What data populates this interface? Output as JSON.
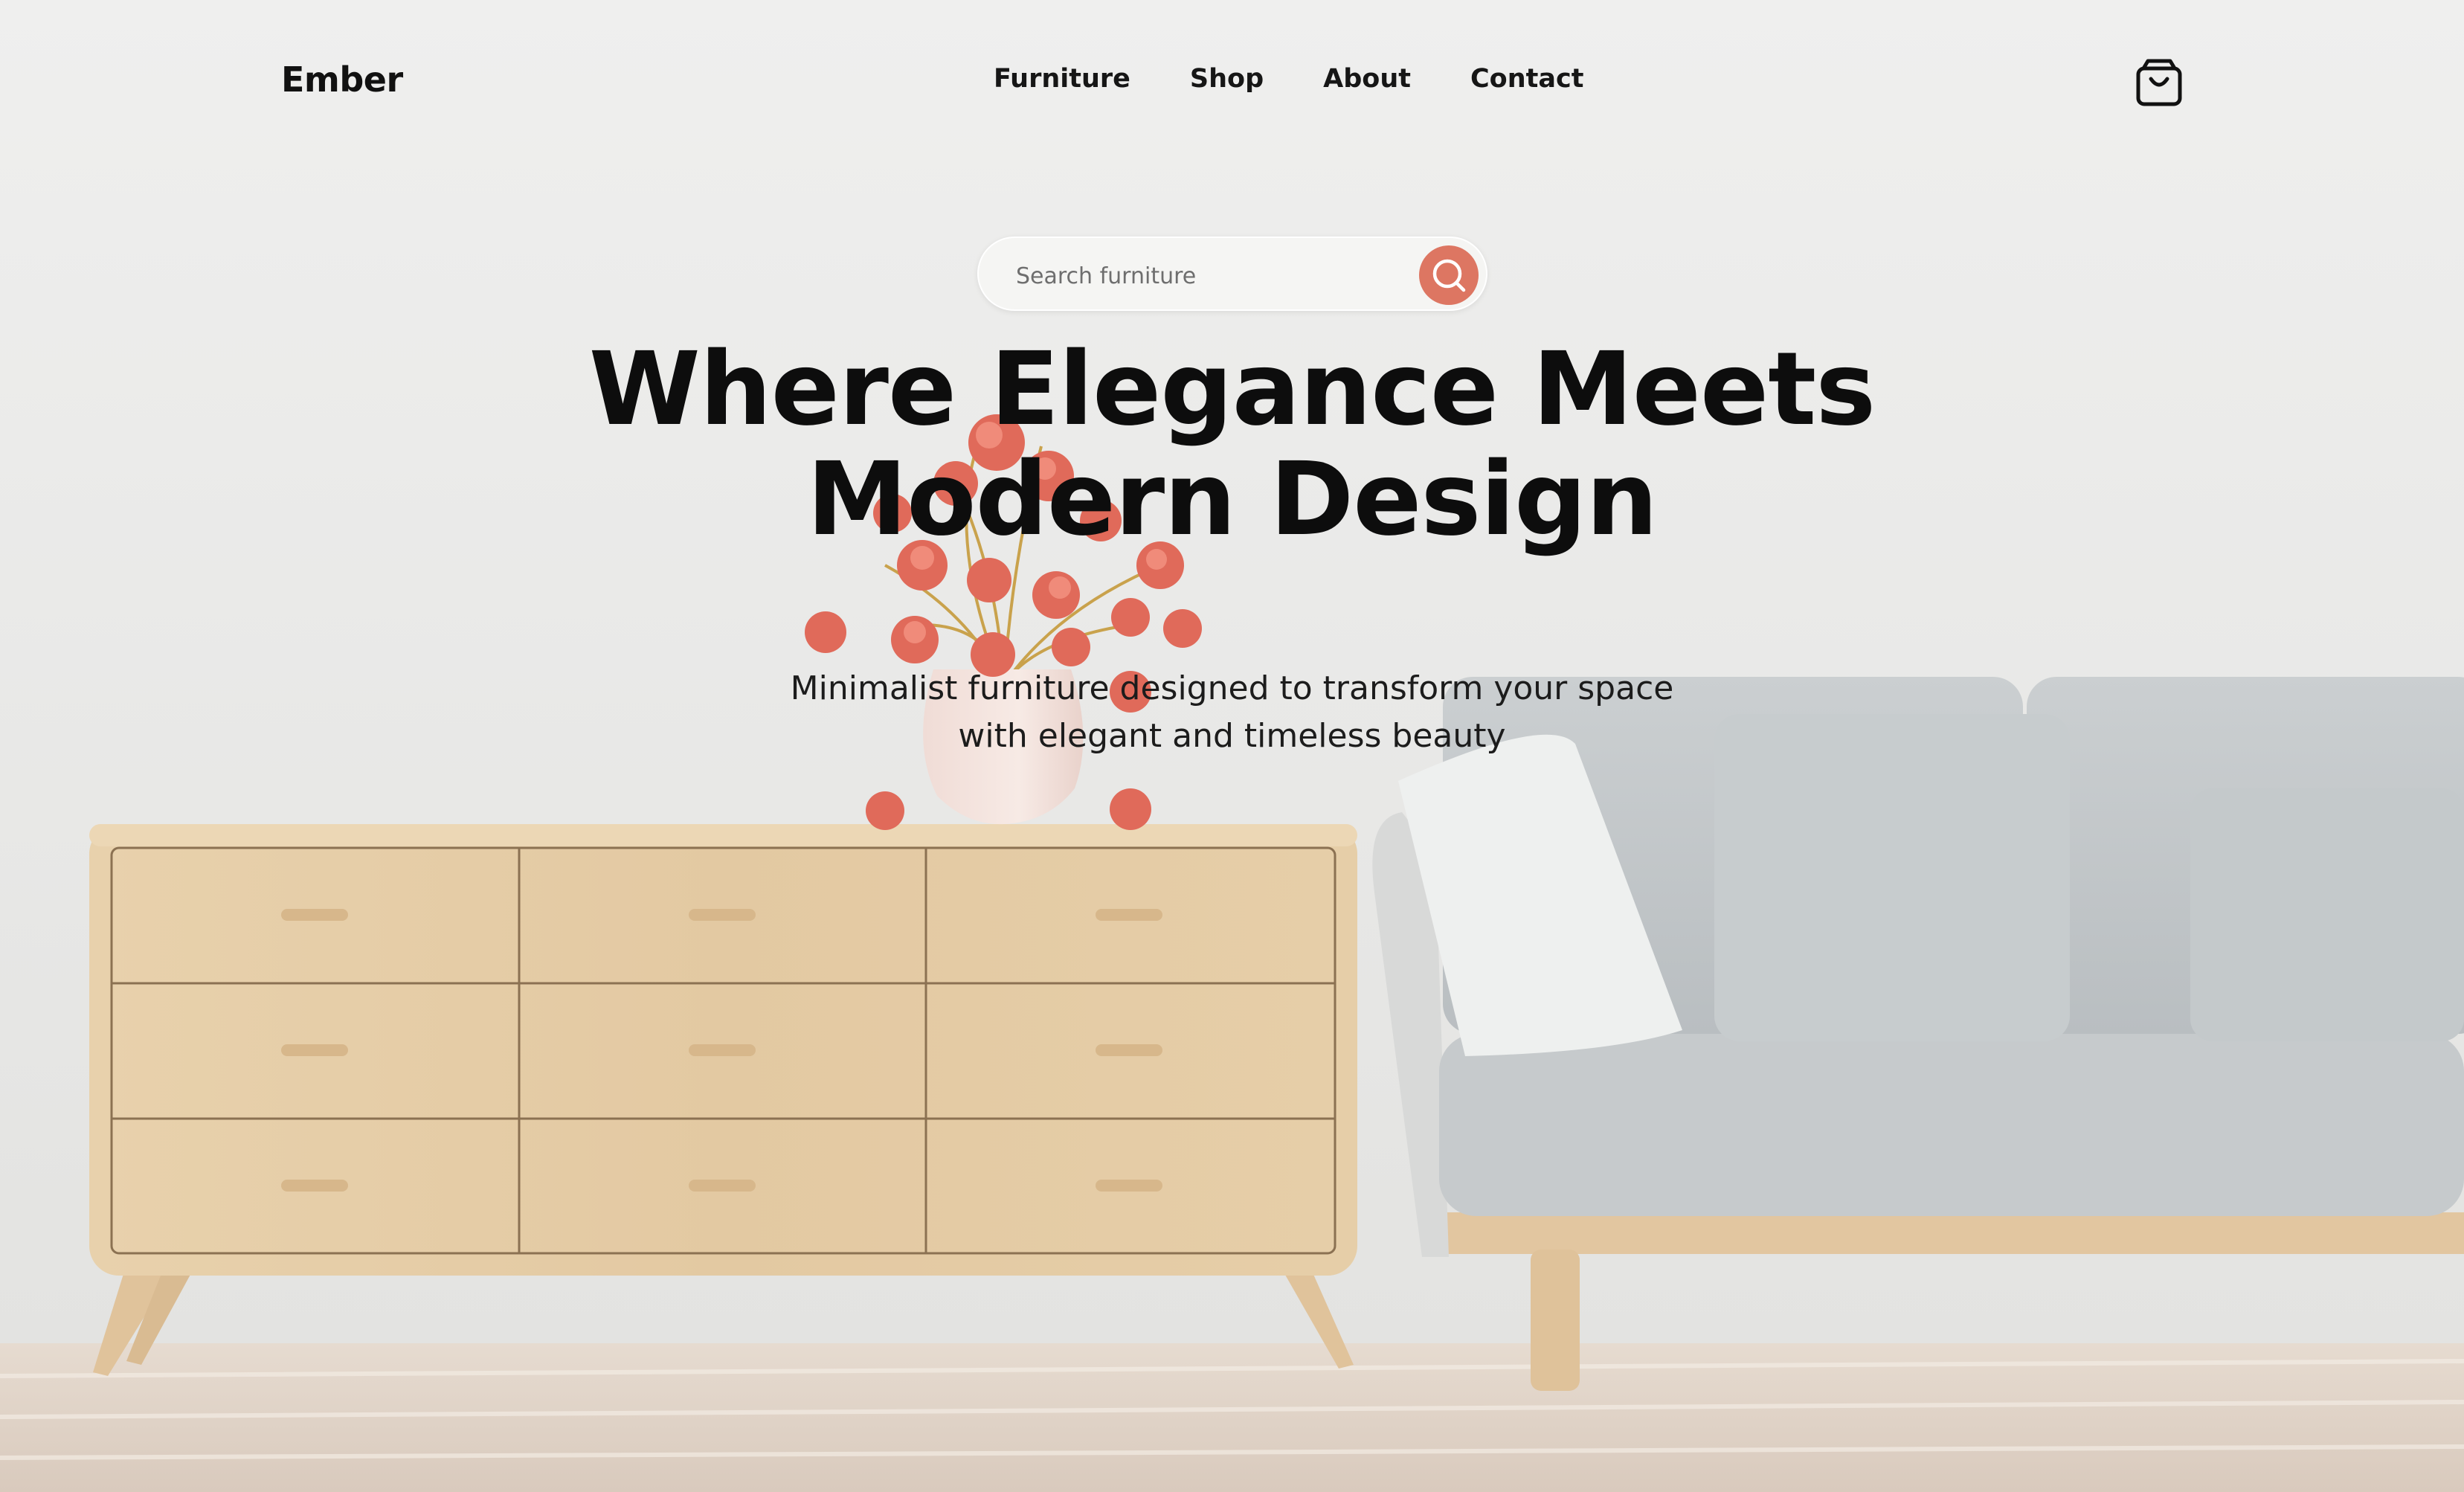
{
  "brand": {
    "name": "Ember"
  },
  "nav": {
    "items": [
      {
        "label": "Furniture"
      },
      {
        "label": "Shop"
      },
      {
        "label": "About"
      },
      {
        "label": "Contact"
      }
    ],
    "cart_icon": "shopping-bag-icon"
  },
  "search": {
    "placeholder": "Search furniture",
    "value": "",
    "icon": "search-icon"
  },
  "hero": {
    "title_line1": "Where Elegance Meets",
    "title_line2": "Modern Design",
    "subtitle_line1": "Minimalist furniture designed to transform your space",
    "subtitle_line2": "with elegant and timeless beauty"
  },
  "colors": {
    "accent": "#dd7662",
    "text": "#0d0d0d",
    "wall": "#ececeb",
    "wood": "#e3c9a0",
    "sofa": "#c3c7c9"
  }
}
